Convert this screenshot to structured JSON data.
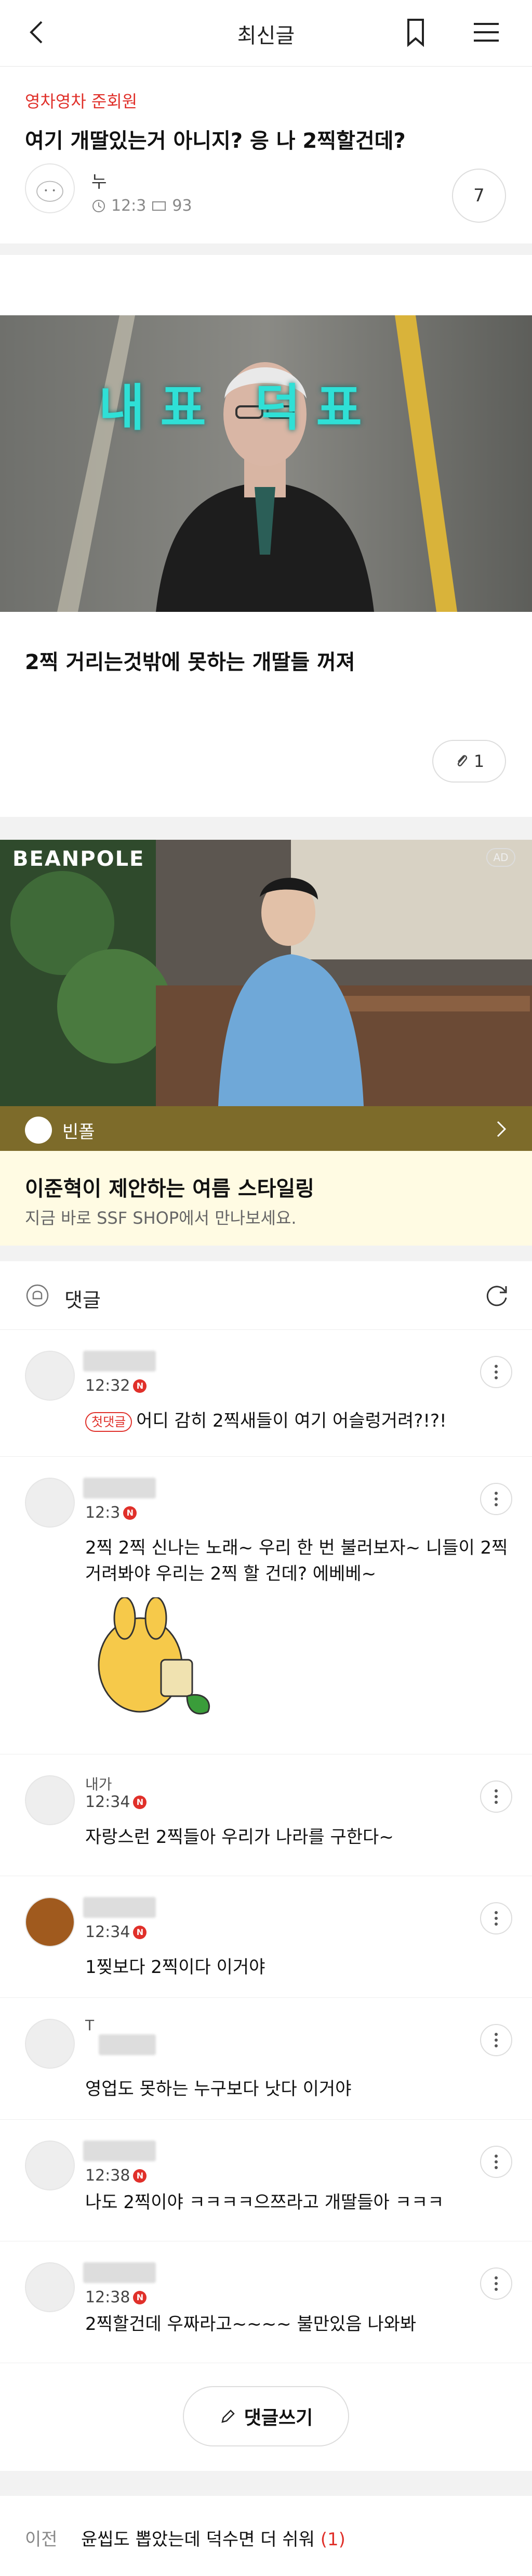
{
  "header": {
    "title": "최신글",
    "back_icon": "chevron-left-icon",
    "bookmark_icon": "bookmark-icon",
    "menu_icon": "hamburger-icon"
  },
  "post": {
    "category": "영차영차 준회원",
    "title": "여기 개딸있는거 아니지? 응 나 2찍할건데?",
    "author": "누",
    "time": "12:3",
    "views": "93",
    "comment_count": "7",
    "hero_text": "내표 덕표",
    "body": "2찍 거리는것밖에 못하는 개딸들 꺼져",
    "attachment_count": "1"
  },
  "ad": {
    "logo_text": "BEANPOLE",
    "ad_mark": "AD",
    "brand": "빈폴",
    "title": "이준혁이 제안하는 여름 스타일링",
    "subtitle": "지금 바로 SSF SHOP에서 만나보세요."
  },
  "comments_section": {
    "label": "댓글",
    "items": [
      {
        "time": "12:32",
        "first_badge": "첫댓글",
        "text": "어디 감히 2찍새들이 여기 어슬렁거려?!?!"
      },
      {
        "time": "12:3",
        "text": "2찍 2찍 신나는 노래~ 우리 한 번 불러보자~ 니들이 2찍 거려봐야 우리는 2찍 할 건데? 에베베~"
      },
      {
        "name_partial": "내가",
        "time": "12:34",
        "text": "자랑스런 2찍들아 우리가 나라를 구한다~"
      },
      {
        "time": "12:34",
        "text": "1찢보다 2찍이다 이거야"
      },
      {
        "name_partial": "T",
        "time": "12:34",
        "text": "영업도 못하는 누구보다 낫다 이거야"
      },
      {
        "time": "12:38",
        "text": "나도 2찍이야 ㅋㅋㅋㅋ으쯔라고 개딸들아 ㅋㅋㅋ"
      },
      {
        "time": "12:38",
        "text": "2찍할건데 우짜라고~~~~ 불만있음 나와봐"
      }
    ],
    "write_button": "댓글쓰기"
  },
  "prev_post": {
    "label": "이전",
    "title": "윤씹도 뽑았는데 덕수면 더 쉬워",
    "count": "(1)"
  },
  "colors": {
    "accent": "#e0302a",
    "ad_bar": "#7d6b2a",
    "ad_copy_bg": "#fffbe3"
  }
}
